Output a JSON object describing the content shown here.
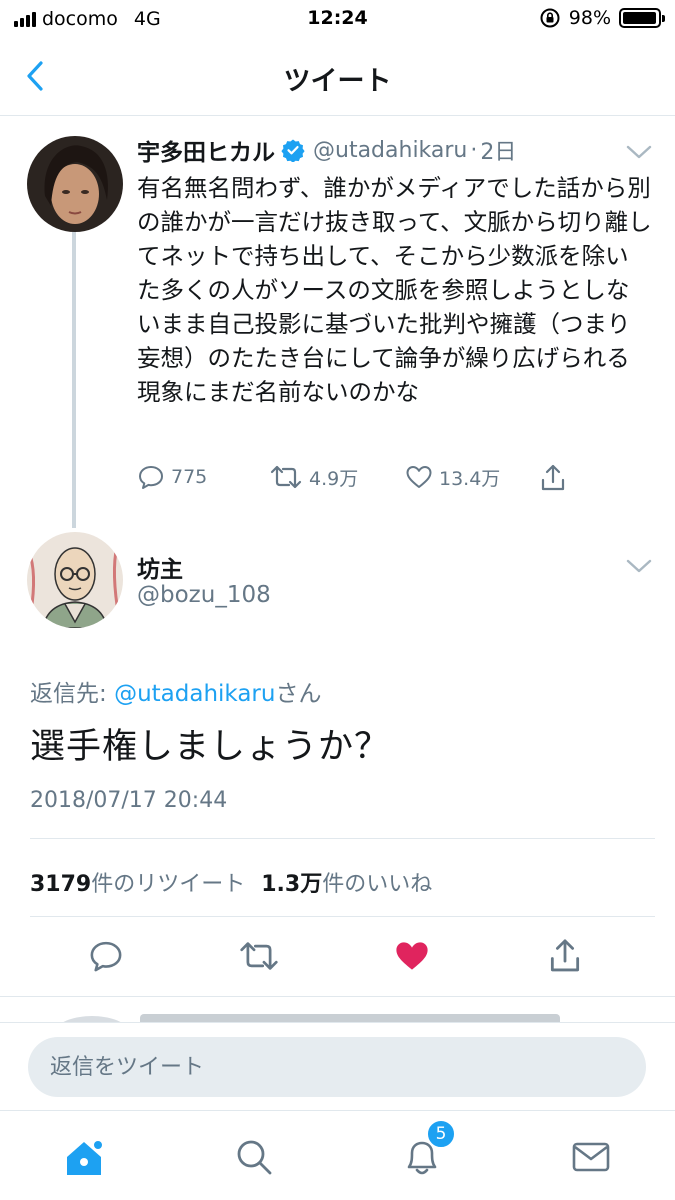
{
  "status_bar": {
    "carrier": "docomo",
    "network": "4G",
    "time": "12:24",
    "battery": "98%",
    "battery_level": 0.98
  },
  "header": {
    "title": "ツイート",
    "back_icon": "chevron-left-icon"
  },
  "original_tweet": {
    "display_name": "宇多田ヒカル",
    "verified": true,
    "handle": "@utadahikaru",
    "separator": "·",
    "time_ago": "2日",
    "text": "有名無名問わず、誰かがメディアでした話から別の誰かが一言だけ抜き取って、文脈から切り離してネットで持ち出して、そこから少数派を除いた多くの人がソースの文脈を参照しようとしないまま自己投影に基づいた批判や擁護（つまり妄想）のたたき台にして論争が繰り広げられる現象にまだ名前ないのかな",
    "reply_count": "775",
    "retweet_count": "4.9万",
    "like_count": "13.4万"
  },
  "reply_tweet": {
    "display_name": "坊主",
    "handle": "@bozu_108",
    "replying_to_prefix": "返信先: ",
    "replying_to_handle": "@utadahikaru",
    "replying_to_suffix": "さん",
    "text": "選手権しましょうか？",
    "timestamp": "2018/07/17 20:44",
    "retweet_count": "3179",
    "retweet_label": "件のリツイート",
    "like_count": "1.3万",
    "like_label": "件のいいね",
    "liked": true
  },
  "composer": {
    "placeholder": "返信をツイート"
  },
  "tab_bar": {
    "items": [
      "home-icon",
      "search-icon",
      "notifications-icon",
      "messages-icon"
    ],
    "notification_badge": "5"
  },
  "colors": {
    "accent": "#1da1f2",
    "like": "#e0245e",
    "secondary_text": "#657786",
    "divider": "#e1e8ed"
  }
}
